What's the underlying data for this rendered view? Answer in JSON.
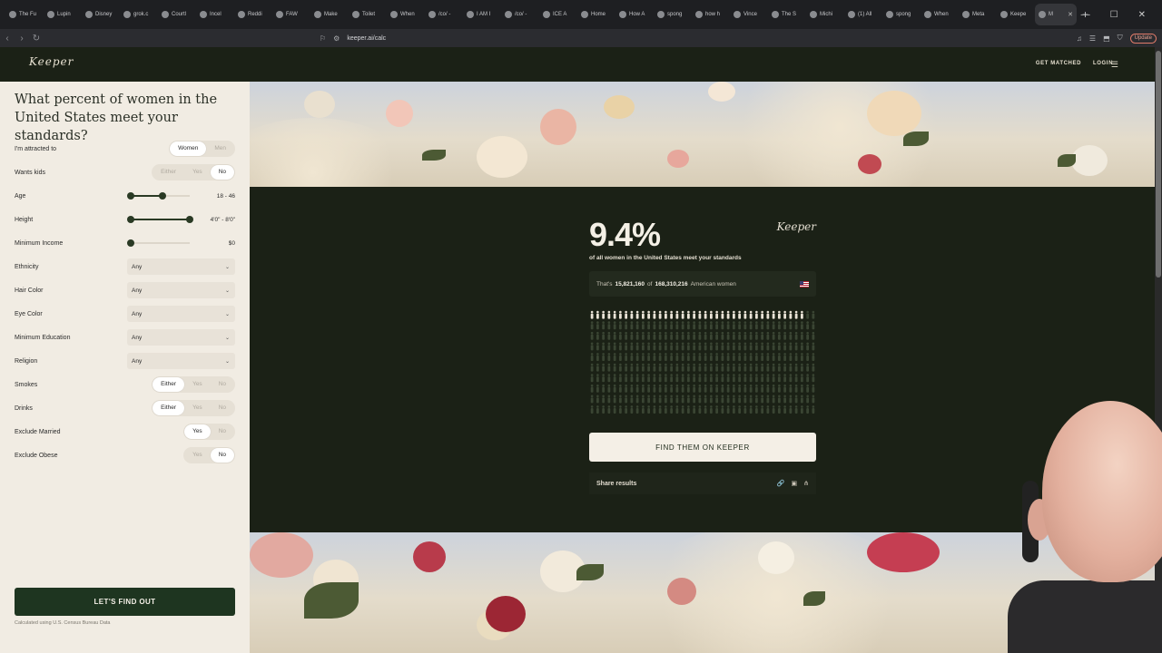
{
  "browser": {
    "tabs": [
      "The Fu",
      "Lupin",
      "Disney",
      "grok.c",
      "Courtl",
      "Incel",
      "Reddi",
      "FAW",
      "Make",
      "Toilet",
      "When",
      "/co/ -",
      "I AM I",
      "/co/ -",
      "ICE A",
      "Home",
      "How A",
      "spong",
      "how h",
      "Vince",
      "The S",
      "Michi",
      "(1) All",
      "spong",
      "When",
      "Meta",
      "Keepe",
      "M"
    ],
    "active_tab_index": 27,
    "url": "keeper.ai/calc",
    "update_label": "Update"
  },
  "site": {
    "logo": "Keeper",
    "nav": [
      "GET MATCHED",
      "LOGIN"
    ]
  },
  "form": {
    "title": "What percent of women in the United States meet your standards?",
    "attracted": {
      "label": "I'm attracted to",
      "options": [
        "Women",
        "Men"
      ],
      "selected": "Women"
    },
    "kids": {
      "label": "Wants kids",
      "options": [
        "Either",
        "Yes",
        "No"
      ],
      "selected": "No"
    },
    "age": {
      "label": "Age",
      "value": "18 - 46"
    },
    "height": {
      "label": "Height",
      "value": "4'0\" - 8'0\""
    },
    "income": {
      "label": "Minimum Income",
      "value": "$0"
    },
    "selects": [
      {
        "label": "Ethnicity",
        "value": "Any"
      },
      {
        "label": "Hair Color",
        "value": "Any"
      },
      {
        "label": "Eye Color",
        "value": "Any"
      },
      {
        "label": "Minimum Education",
        "value": "Any"
      },
      {
        "label": "Religion",
        "value": "Any"
      }
    ],
    "smokes": {
      "label": "Smokes",
      "options": [
        "Either",
        "Yes",
        "No"
      ],
      "selected": "Either"
    },
    "drinks": {
      "label": "Drinks",
      "options": [
        "Either",
        "Yes",
        "No"
      ],
      "selected": "Either"
    },
    "married": {
      "label": "Exclude Married",
      "options": [
        "Yes",
        "No"
      ],
      "selected": "Yes"
    },
    "obese": {
      "label": "Exclude Obese",
      "options": [
        "Yes",
        "No"
      ],
      "selected": "No"
    },
    "cta": "LET'S FIND OUT",
    "footnote": "Calculated using U.S. Census Bureau Data"
  },
  "result": {
    "percent": "9.4%",
    "subtitle": "of all women in the United States meet your standards",
    "signature": "Keeper",
    "count_prefix": "That's",
    "count": "15,821,160",
    "count_of": "of",
    "total": "168,310,216",
    "count_suffix": "American women",
    "people_highlight_fraction": 0.094,
    "find_button": "FIND THEM ON KEEPER",
    "share_label": "Share results"
  },
  "colors": {
    "dark_green": "#1b2116",
    "cream": "#f1ece3",
    "cta_green": "#1e3520"
  }
}
